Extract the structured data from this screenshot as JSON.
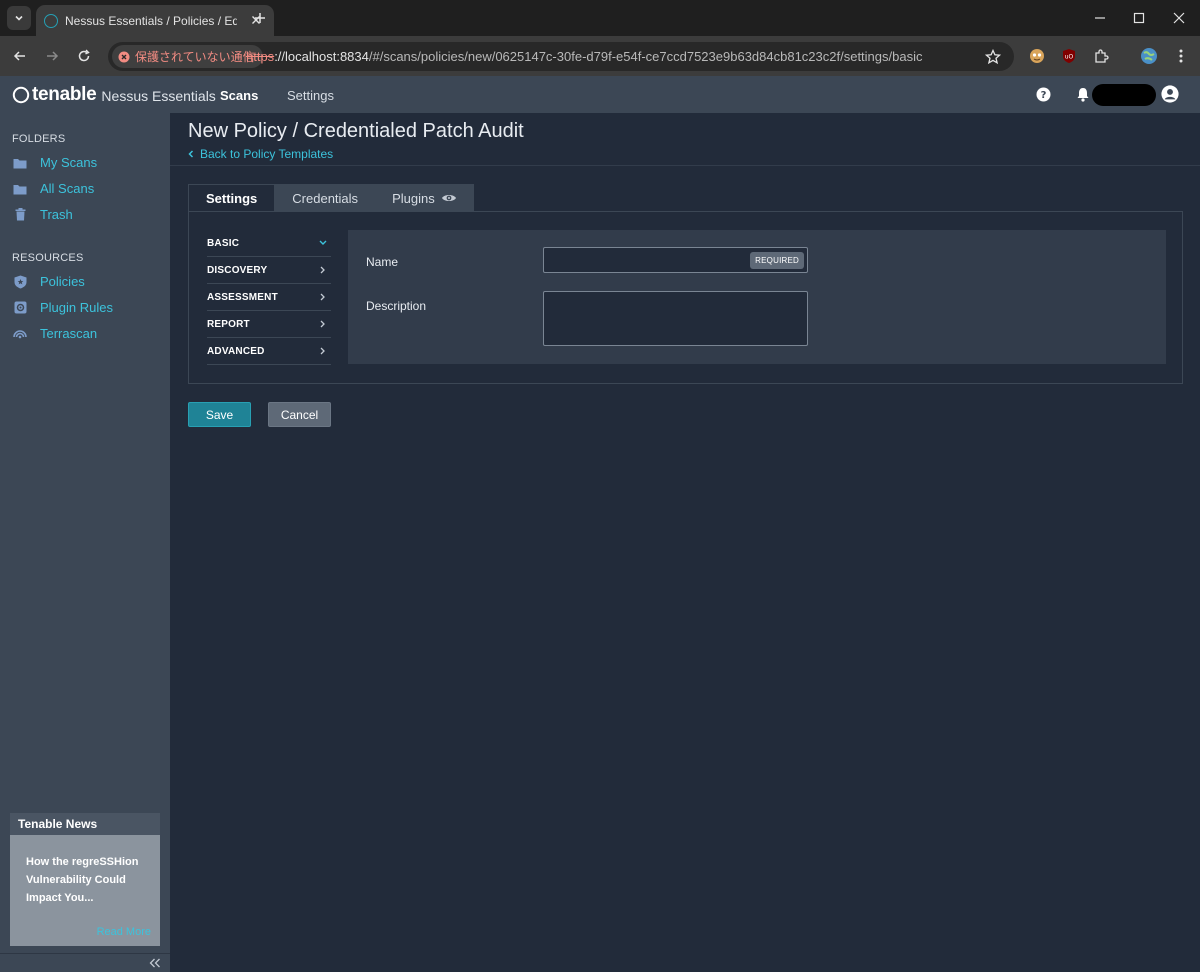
{
  "browser": {
    "tab_title": "Nessus Essentials / Policies / Edit",
    "security_label": "保護されていない通信",
    "url_scheme": "https",
    "url_host": "://localhost:8834",
    "url_path": "/#/scans/policies/new/0625147c-30fe-d79f-e54f-ce7ccd7523e9b63d84cb81c23c2f/settings/basic"
  },
  "header": {
    "brand": "tenable",
    "product": "Nessus Essentials",
    "nav": [
      {
        "label": "Scans",
        "active": true
      },
      {
        "label": "Settings",
        "active": false
      }
    ]
  },
  "sidebar": {
    "folders_title": "FOLDERS",
    "folders": [
      {
        "label": "My Scans",
        "icon": "folder-icon"
      },
      {
        "label": "All Scans",
        "icon": "folder-icon"
      },
      {
        "label": "Trash",
        "icon": "trash-icon"
      }
    ],
    "resources_title": "RESOURCES",
    "resources": [
      {
        "label": "Policies",
        "icon": "shield-icon"
      },
      {
        "label": "Plugin Rules",
        "icon": "plugin-rules-icon"
      },
      {
        "label": "Terrascan",
        "icon": "terrascan-icon"
      }
    ],
    "news": {
      "title": "Tenable News",
      "headline": "How the regreSSHion Vulnerability Could Impact You...",
      "read_more": "Read More"
    }
  },
  "main": {
    "title": "New Policy / Credentialed Patch Audit",
    "back_link": "Back to Policy Templates",
    "tabs": [
      {
        "label": "Settings",
        "active": true
      },
      {
        "label": "Credentials",
        "active": false
      },
      {
        "label": "Plugins",
        "active": false
      }
    ],
    "settings_nav": [
      {
        "label": "BASIC",
        "expanded": true
      },
      {
        "label": "DISCOVERY",
        "expanded": false
      },
      {
        "label": "ASSESSMENT",
        "expanded": false
      },
      {
        "label": "REPORT",
        "expanded": false
      },
      {
        "label": "ADVANCED",
        "expanded": false
      }
    ],
    "form": {
      "name_label": "Name",
      "name_value": "",
      "required_badge": "REQUIRED",
      "description_label": "Description",
      "description_value": ""
    },
    "buttons": {
      "save": "Save",
      "cancel": "Cancel"
    }
  },
  "colors": {
    "accent": "#3cc3dc",
    "save_button": "#1f8396",
    "background": "#222b3a",
    "sidebar": "#3c4755"
  }
}
